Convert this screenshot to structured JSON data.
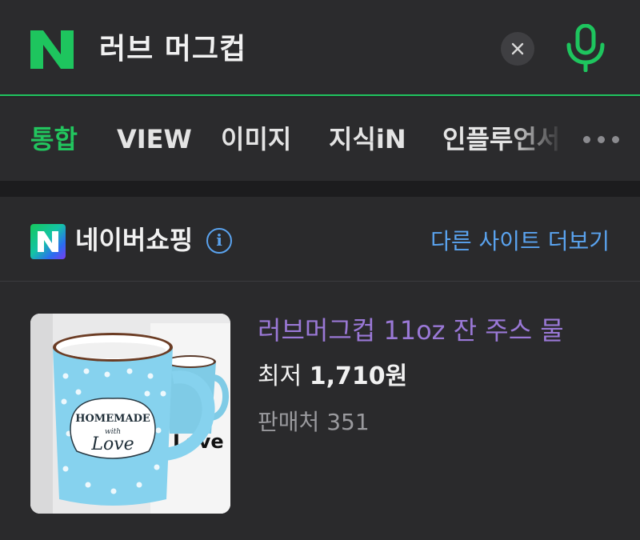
{
  "search": {
    "logo_letter": "N",
    "query": "러브 머그컵",
    "clear_symbol": "×"
  },
  "tabs": [
    {
      "label": "통합",
      "active": true
    },
    {
      "label": "VIEW",
      "active": false
    },
    {
      "label": "이미지",
      "active": false
    },
    {
      "label": "지식iN",
      "active": false
    },
    {
      "label": "인플루언서",
      "active": false
    }
  ],
  "shopping": {
    "logo_letter": "N",
    "title": "네이버쇼핑",
    "info_symbol": "i",
    "more_link": "다른 사이트 더보기",
    "product": {
      "image_text_line1": "HOMEMADE",
      "image_text_line2": "with",
      "image_text_line3": "Love",
      "title": "러브머그컵 11oz 잔 주스 물",
      "price_prefix": "최저",
      "price": "1,710원",
      "seller_prefix": "판매처",
      "seller_count": "351"
    }
  },
  "colors": {
    "brand_green": "#22c55e",
    "link_blue": "#5aa3ef",
    "visited_purple": "#9a78d6",
    "background": "#262628"
  },
  "icons": {
    "logo": "naver-logo-icon",
    "clear": "close-icon",
    "mic": "microphone-icon",
    "more": "more-dots-icon",
    "info": "info-icon"
  }
}
